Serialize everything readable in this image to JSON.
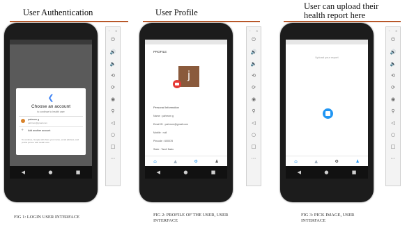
{
  "panels": [
    {
      "heading": "User Authentication",
      "caption": "FIG 1: LOGIN USER INTERFACE",
      "dialog": {
        "title": "Choose an account",
        "subtitle": "to continue to health care",
        "account_name": "pahrrom g",
        "account_email": "pahrrom@gmail.com",
        "add_account": "Add another account",
        "footer": "To continue, Google will share your name, email address, and profile picture with health care."
      }
    },
    {
      "heading": "User Profile",
      "caption": "FIG 2: Profile of the user, USER INTERFACE",
      "profile": {
        "title": "PROFILE",
        "avatar_letter": "j",
        "section_label": "Personal Information",
        "fields": [
          "Name : pahrrom g",
          "Email ID : pahrrom@gmail.com",
          "Mobile : null",
          "Pincode : 600078",
          "State : Tamil Nadu"
        ]
      }
    },
    {
      "heading": "User can upload their health report here",
      "caption": "FIG 3: PICK IMAGE, USER INTERFACE",
      "upload": {
        "prompt": "Upload your report"
      }
    }
  ],
  "colors": {
    "rule": "#b8582a",
    "phone_body": "#1c1c1c",
    "avatar_bg": "#8a5a3c",
    "fab_red": "#e53935",
    "fab_blue": "#2196f3"
  }
}
